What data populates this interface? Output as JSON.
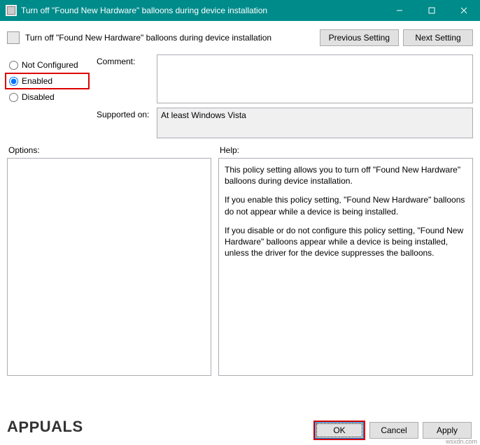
{
  "window": {
    "title": "Turn off \"Found New Hardware\" balloons during device installation"
  },
  "header": {
    "policy_title": "Turn off \"Found New Hardware\" balloons during device installation",
    "prev_btn": "Previous Setting",
    "next_btn": "Next Setting"
  },
  "radios": {
    "not_configured": "Not Configured",
    "enabled": "Enabled",
    "disabled": "Disabled"
  },
  "fields": {
    "comment_label": "Comment:",
    "comment_value": "",
    "supported_label": "Supported on:",
    "supported_value": "At least Windows Vista"
  },
  "sections": {
    "options_label": "Options:",
    "help_label": "Help:"
  },
  "help": {
    "p1": "This policy setting allows you to turn off \"Found New Hardware\" balloons during device installation.",
    "p2": "If you enable this policy setting, \"Found New Hardware\" balloons do not appear while a device is being installed.",
    "p3": "If you disable or do not configure this policy setting, \"Found New Hardware\" balloons appear while a device is being installed, unless the driver for the device suppresses the balloons."
  },
  "buttons": {
    "ok": "OK",
    "cancel": "Cancel",
    "apply": "Apply"
  },
  "watermark": {
    "text_left": "A",
    "text_mid": "PP",
    "text_right": "UALS"
  },
  "source": "wsxdn.com"
}
